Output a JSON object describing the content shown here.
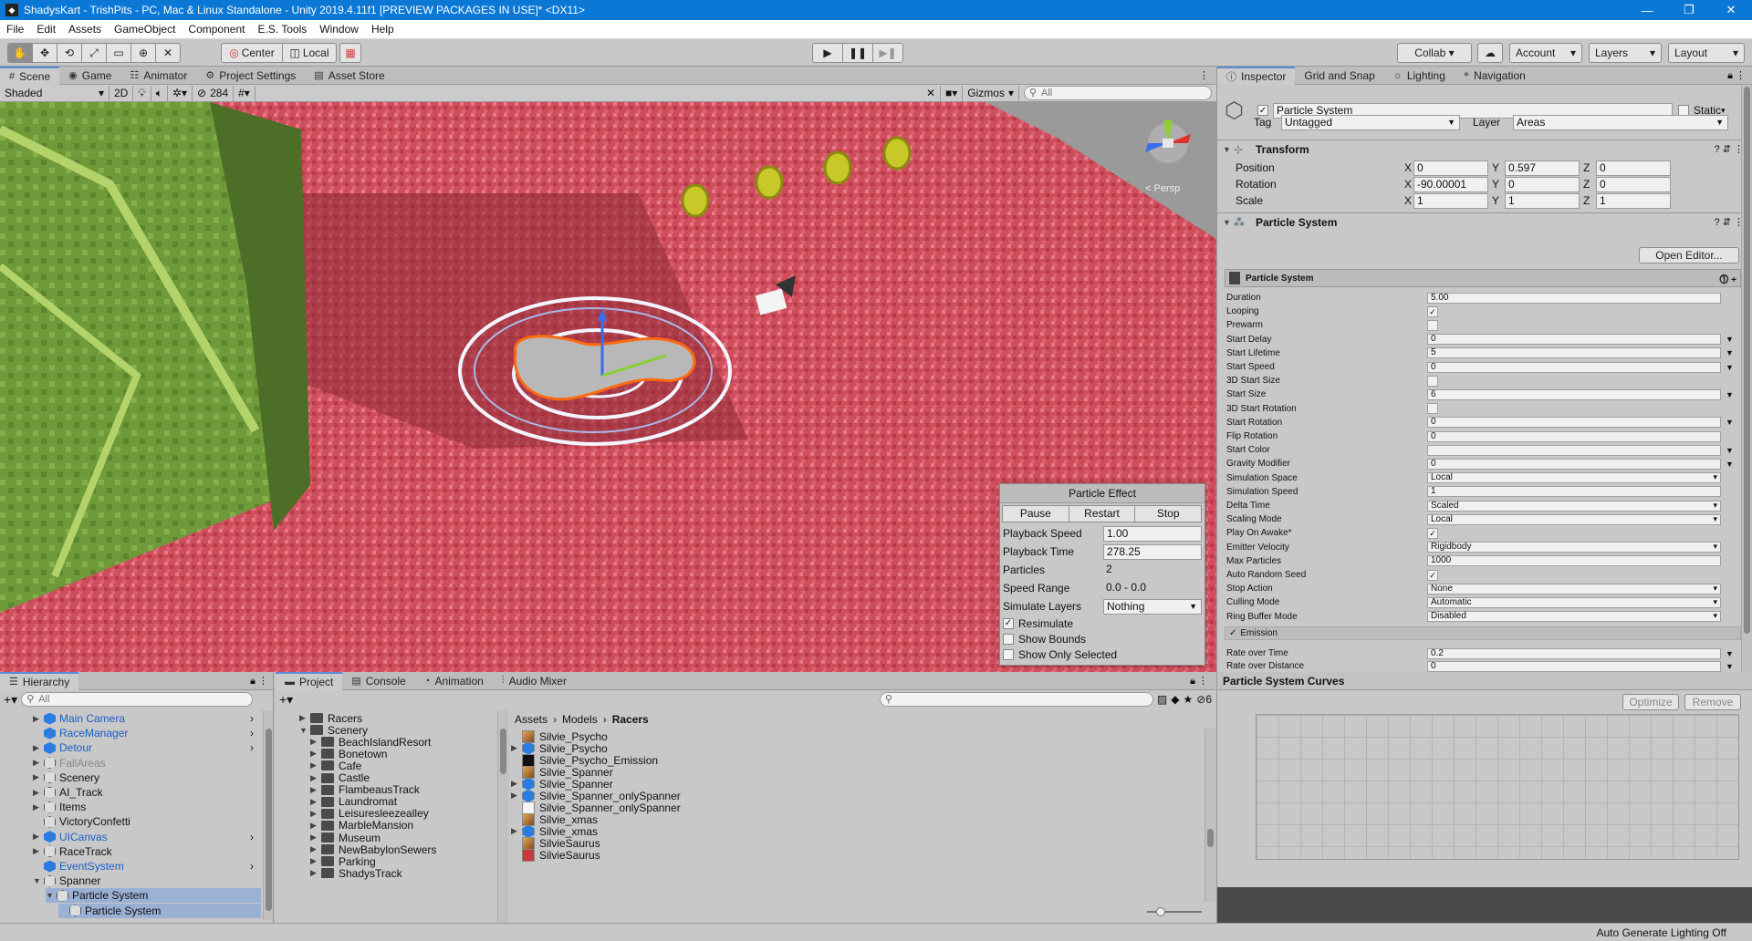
{
  "window": {
    "title": "ShadysKart - TrishPits - PC, Mac & Linux Standalone - Unity 2019.4.11f1 [PREVIEW PACKAGES IN USE]* <DX11>",
    "min": "—",
    "max": "❐",
    "close": "✕"
  },
  "menu": [
    "File",
    "Edit",
    "Assets",
    "GameObject",
    "Component",
    "E.S. Tools",
    "Window",
    "Help"
  ],
  "toolbar": {
    "center": "Center",
    "local": "Local",
    "collab": "Collab ▾",
    "account": "Account",
    "layers": "Layers",
    "layout": "Layout"
  },
  "scene_tabs": [
    "Scene",
    "Game",
    "Animator",
    "Project Settings",
    "Asset Store"
  ],
  "scene_toolbar": {
    "shaded": "Shaded",
    "mode_2d": "2D",
    "hidden_count": "284",
    "gizmos": "Gizmos",
    "search_placeholder": "All",
    "persp": "< Persp"
  },
  "particle_effect": {
    "title": "Particle Effect",
    "buttons": [
      "Pause",
      "Restart",
      "Stop"
    ],
    "playback_speed_label": "Playback Speed",
    "playback_speed": "1.00",
    "playback_time_label": "Playback Time",
    "playback_time": "278.25",
    "particles_label": "Particles",
    "particles": "2",
    "speed_range_label": "Speed Range",
    "speed_range": "0.0 - 0.0",
    "simulate_layers_label": "Simulate Layers",
    "simulate_layers": "Nothing",
    "resimulate": "Resimulate",
    "show_bounds": "Show Bounds",
    "show_only_selected": "Show Only Selected"
  },
  "inspector_tabs": [
    "Inspector",
    "Grid and Snap",
    "Lighting",
    "Navigation"
  ],
  "inspector": {
    "object_name": "Particle System",
    "static_label": "Static",
    "tag_label": "Tag",
    "tag": "Untagged",
    "layer_label": "Layer",
    "layer": "Areas",
    "transform": {
      "title": "Transform",
      "position_label": "Position",
      "rotation_label": "Rotation",
      "scale_label": "Scale",
      "position": [
        "0",
        "0.597",
        "0"
      ],
      "rotation": [
        "-90.00001",
        "0",
        "0"
      ],
      "scale": [
        "1",
        "1",
        "1"
      ]
    },
    "ps_title": "Particle System",
    "open_editor": "Open Editor...",
    "ps_header": "Particle System",
    "ps_props": [
      {
        "label": "Duration",
        "value": "5.00",
        "kind": "text"
      },
      {
        "label": "Looping",
        "value": "✓",
        "kind": "check"
      },
      {
        "label": "Prewarm",
        "value": "",
        "kind": "check"
      },
      {
        "label": "Start Delay",
        "value": "0",
        "kind": "arrow"
      },
      {
        "label": "Start Lifetime",
        "value": "5",
        "kind": "arrow"
      },
      {
        "label": "Start Speed",
        "value": "0",
        "kind": "arrow"
      },
      {
        "label": "3D Start Size",
        "value": "",
        "kind": "check"
      },
      {
        "label": "Start Size",
        "value": "6",
        "kind": "arrow"
      },
      {
        "label": "3D Start Rotation",
        "value": "",
        "kind": "check"
      },
      {
        "label": "Start Rotation",
        "value": "0",
        "kind": "arrow"
      },
      {
        "label": "Flip Rotation",
        "value": "0",
        "kind": "text"
      },
      {
        "label": "Start Color",
        "value": "",
        "kind": "arrow"
      },
      {
        "label": "Gravity Modifier",
        "value": "0",
        "kind": "arrow"
      },
      {
        "label": "Simulation Space",
        "value": "Local",
        "kind": "dd"
      },
      {
        "label": "Simulation Speed",
        "value": "1",
        "kind": "text"
      },
      {
        "label": "Delta Time",
        "value": "Scaled",
        "kind": "dd"
      },
      {
        "label": "Scaling Mode",
        "value": "Local",
        "kind": "dd"
      },
      {
        "label": "Play On Awake*",
        "value": "✓",
        "kind": "check"
      },
      {
        "label": "Emitter Velocity",
        "value": "Rigidbody",
        "kind": "dd"
      },
      {
        "label": "Max Particles",
        "value": "1000",
        "kind": "text"
      },
      {
        "label": "Auto Random Seed",
        "value": "✓",
        "kind": "check"
      },
      {
        "label": "Stop Action",
        "value": "None",
        "kind": "dd"
      },
      {
        "label": "Culling Mode",
        "value": "Automatic",
        "kind": "dd"
      },
      {
        "label": "Ring Buffer Mode",
        "value": "Disabled",
        "kind": "dd"
      }
    ],
    "emission": "Emission",
    "emission_props": [
      {
        "label": "Rate over Time",
        "value": "0.2"
      },
      {
        "label": "Rate over Distance",
        "value": "0"
      }
    ],
    "curves_title": "Particle System Curves",
    "optimize": "Optimize",
    "remove": "Remove"
  },
  "hierarchy": {
    "tab": "Hierarchy",
    "search_placeholder": "All",
    "items": [
      {
        "name": "Main Camera",
        "depth": 0,
        "color": "blue",
        "arrow": "▶",
        "more": true
      },
      {
        "name": "RaceManager",
        "depth": 0,
        "color": "blue",
        "arrow": "",
        "more": true
      },
      {
        "name": "Detour",
        "depth": 0,
        "color": "blue",
        "arrow": "▶",
        "more": true
      },
      {
        "name": "FallAreas",
        "depth": 0,
        "color": "dim",
        "arrow": "▶",
        "more": false
      },
      {
        "name": "Scenery",
        "depth": 0,
        "color": "normal",
        "arrow": "▶",
        "more": false
      },
      {
        "name": "AI_Track",
        "depth": 0,
        "color": "normal",
        "arrow": "▶",
        "more": false
      },
      {
        "name": "Items",
        "depth": 0,
        "color": "normal",
        "arrow": "▶",
        "more": false
      },
      {
        "name": "VictoryConfetti",
        "depth": 0,
        "color": "normal",
        "arrow": "",
        "more": false
      },
      {
        "name": "UICanvas",
        "depth": 0,
        "color": "blue",
        "arrow": "▶",
        "more": true
      },
      {
        "name": "RaceTrack",
        "depth": 0,
        "color": "normal",
        "arrow": "▶",
        "more": false
      },
      {
        "name": "EventSystem",
        "depth": 0,
        "color": "blue",
        "arrow": "",
        "more": true
      },
      {
        "name": "Spanner",
        "depth": 0,
        "color": "normal",
        "arrow": "▼",
        "more": false
      },
      {
        "name": "Particle System",
        "depth": 1,
        "color": "normal",
        "arrow": "▼",
        "more": false
      },
      {
        "name": "Particle System",
        "depth": 2,
        "color": "normal",
        "arrow": "",
        "more": false
      }
    ]
  },
  "project": {
    "tabs": [
      "Project",
      "Console",
      "Animation",
      "Audio Mixer"
    ],
    "hidden_count": "6",
    "folders": [
      {
        "name": "Racers",
        "depth": 0,
        "arrow": "▶"
      },
      {
        "name": "Scenery",
        "depth": 0,
        "arrow": "▼"
      },
      {
        "name": "BeachIslandResort",
        "depth": 1,
        "arrow": "▶"
      },
      {
        "name": "Bonetown",
        "depth": 1,
        "arrow": "▶"
      },
      {
        "name": "Cafe",
        "depth": 1,
        "arrow": "▶"
      },
      {
        "name": "Castle",
        "depth": 1,
        "arrow": "▶"
      },
      {
        "name": "FlambeausTrack",
        "depth": 1,
        "arrow": "▶"
      },
      {
        "name": "Laundromat",
        "depth": 1,
        "arrow": "▶"
      },
      {
        "name": "Leisuresleezealley",
        "depth": 1,
        "arrow": "▶"
      },
      {
        "name": "MarbleMansion",
        "depth": 1,
        "arrow": "▶"
      },
      {
        "name": "Museum",
        "depth": 1,
        "arrow": "▶"
      },
      {
        "name": "NewBabylonSewers",
        "depth": 1,
        "arrow": "▶"
      },
      {
        "name": "Parking",
        "depth": 1,
        "arrow": "▶"
      },
      {
        "name": "ShadysTrack",
        "depth": 1,
        "arrow": "▶"
      }
    ],
    "breadcrumb": [
      "Assets",
      "Models",
      "Racers"
    ],
    "assets": [
      {
        "name": "Silvie_Psycho",
        "icon": "tex",
        "arrow": ""
      },
      {
        "name": "Silvie_Psycho",
        "icon": "model",
        "arrow": "▶"
      },
      {
        "name": "Silvie_Psycho_Emission",
        "icon": "black",
        "arrow": ""
      },
      {
        "name": "Silvie_Spanner",
        "icon": "tex",
        "arrow": ""
      },
      {
        "name": "Silvie_Spanner",
        "icon": "model",
        "arrow": "▶"
      },
      {
        "name": "Silvie_Spanner_onlySpanner",
        "icon": "model",
        "arrow": "▶"
      },
      {
        "name": "Silvie_Spanner_onlySpanner",
        "icon": "white",
        "arrow": ""
      },
      {
        "name": "Silvie_xmas",
        "icon": "tex",
        "arrow": ""
      },
      {
        "name": "Silvie_xmas",
        "icon": "model",
        "arrow": "▶"
      },
      {
        "name": "SilvieSaurus",
        "icon": "tex",
        "arrow": ""
      },
      {
        "name": "SilvieSaurus",
        "icon": "red",
        "arrow": ""
      }
    ]
  },
  "status": {
    "right": "Auto Generate Lighting Off"
  },
  "colors": {
    "title_bar": "#0b78d6",
    "scene_floor": "#cc4a57",
    "link_blue": "#1a5fc8",
    "selection": "#3d6fb7"
  }
}
